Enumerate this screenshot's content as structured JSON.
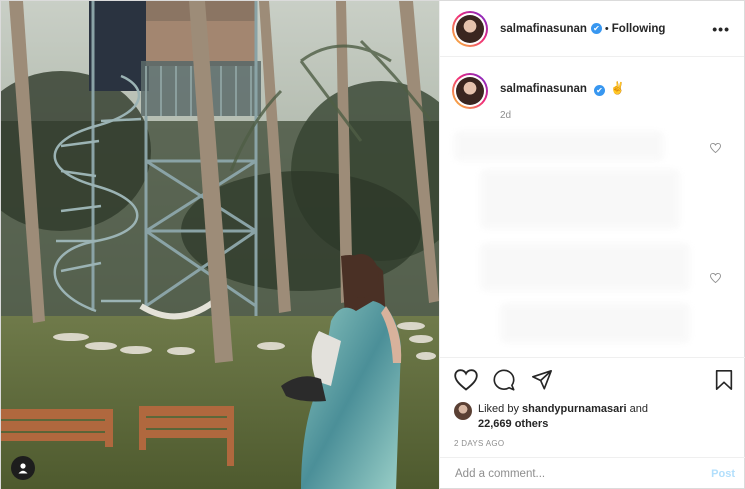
{
  "header": {
    "username": "salmafinasunan",
    "verified_mark": "✔",
    "separator": "•",
    "follow_status": "Following",
    "more_label": "•••"
  },
  "caption": {
    "username": "salmafinasunan",
    "verified_mark": "✔",
    "emoji": "✌",
    "time_ago": "2d"
  },
  "comments": {
    "like_icons": [
      "heart-outline",
      "heart-outline"
    ]
  },
  "actions": {
    "icons": [
      "heart-icon",
      "comment-icon",
      "share-icon",
      "bookmark-icon"
    ]
  },
  "likes": {
    "prefix": "Liked by ",
    "liker": "shandypurnamasari",
    "conjunction": " and",
    "others": "22,669 others"
  },
  "date": "2 DAYS AGO",
  "comment_box": {
    "placeholder": "Add a comment...",
    "post_label": "Post"
  },
  "colors": {
    "accent": "#3897f0",
    "post_button_disabled": "#b2dffc",
    "text": "#262626",
    "muted": "#8e8e8e",
    "border": "#dbdbdb"
  }
}
